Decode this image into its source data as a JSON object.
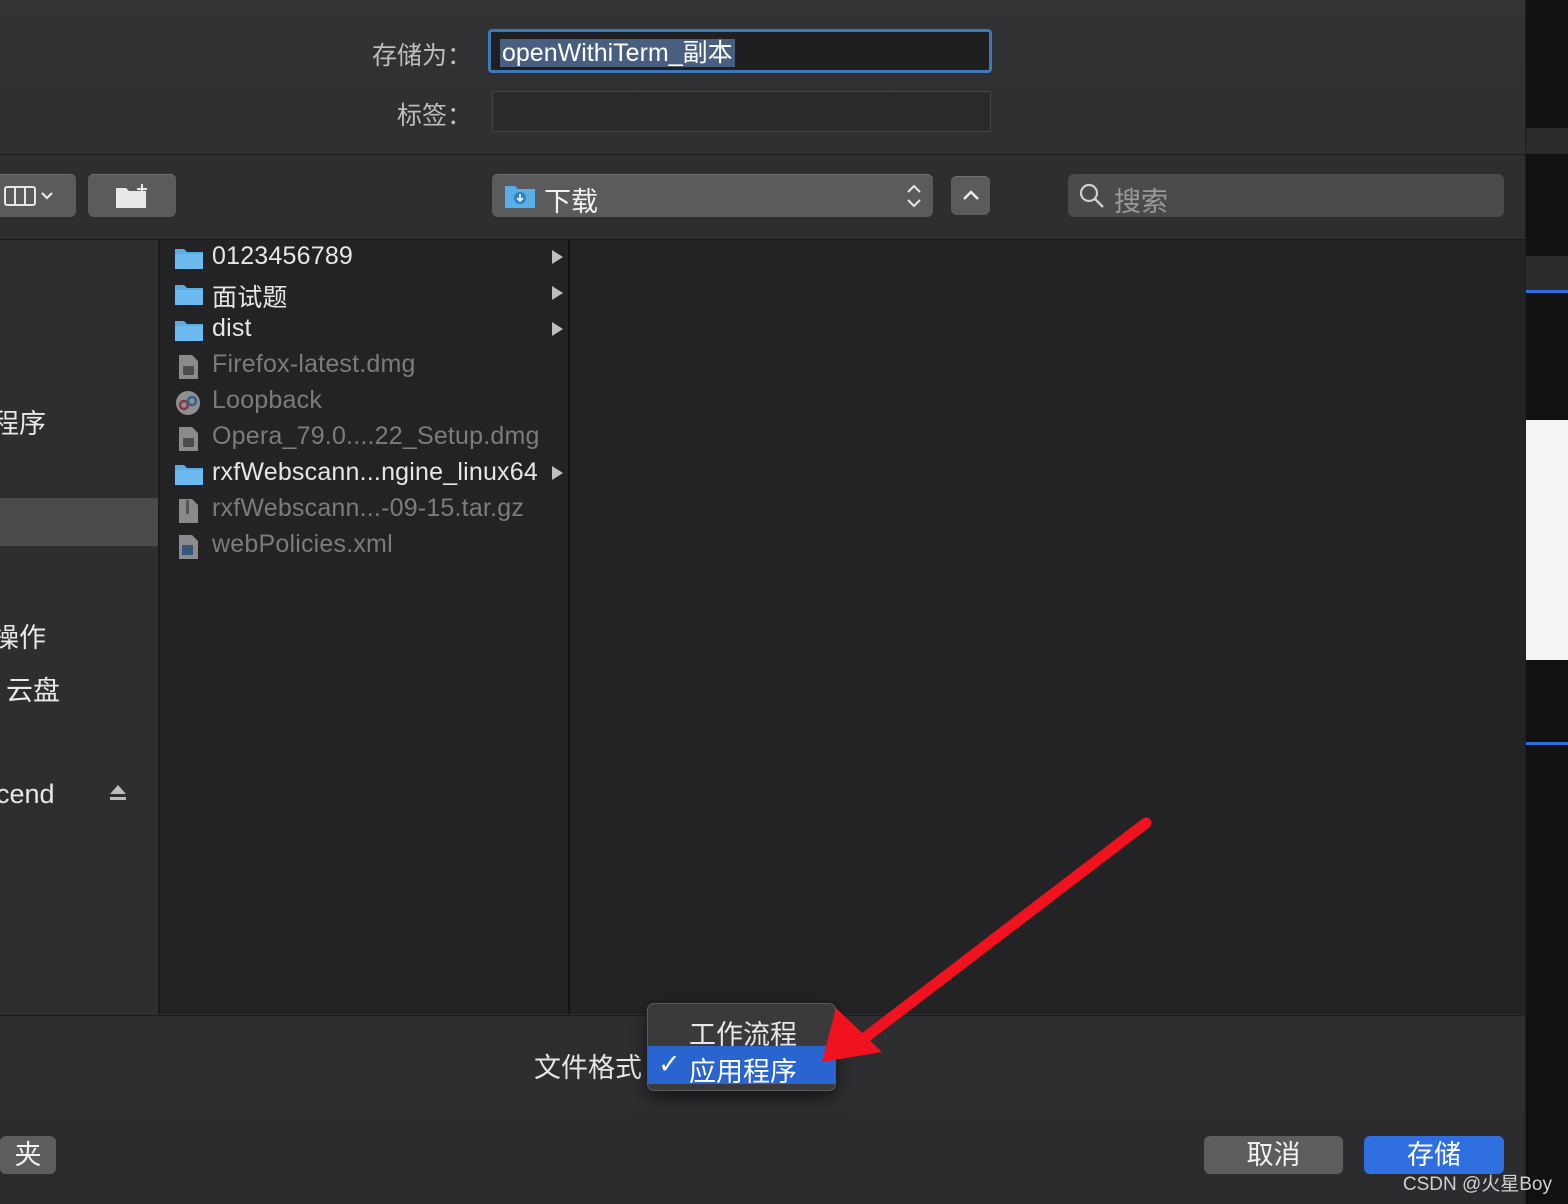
{
  "save_as": {
    "label": "存储为：",
    "value": "openWithiTerm_副本"
  },
  "tags": {
    "label": "标签：",
    "value": ""
  },
  "toolbar": {
    "location": "下载",
    "search_placeholder": "搜索"
  },
  "sidebar": {
    "items": [
      {
        "label": "程序"
      },
      {
        "label": "操作"
      },
      {
        "label": "云盘"
      },
      {
        "label": "cend"
      }
    ]
  },
  "files": [
    {
      "name": "0123456789",
      "type": "folder",
      "enabled": true
    },
    {
      "name": "面试题",
      "type": "folder",
      "enabled": true
    },
    {
      "name": "dist",
      "type": "folder",
      "enabled": true
    },
    {
      "name": "Firefox-latest.dmg",
      "type": "dmg",
      "enabled": false
    },
    {
      "name": "Loopback",
      "type": "app",
      "enabled": false
    },
    {
      "name": "Opera_79.0....22_Setup.dmg",
      "type": "dmg",
      "enabled": false
    },
    {
      "name": "rxfWebscann...ngine_linux64",
      "type": "folder",
      "enabled": true
    },
    {
      "name": "rxfWebscann...-09-15.tar.gz",
      "type": "archive",
      "enabled": false
    },
    {
      "name": "webPolicies.xml",
      "type": "xml",
      "enabled": false
    }
  ],
  "file_format": {
    "label": "文件格式",
    "options": [
      "工作流程",
      "应用程序"
    ],
    "selected": "应用程序",
    "checkmark": "✓"
  },
  "buttons": {
    "new_folder_partial": "夹",
    "cancel": "取消",
    "save": "存储"
  },
  "watermark": "CSDN @火星Boy",
  "colors": {
    "accent": "#2f6fe0",
    "annotation_arrow": "#f0121f",
    "folder": "#5aaee8"
  }
}
